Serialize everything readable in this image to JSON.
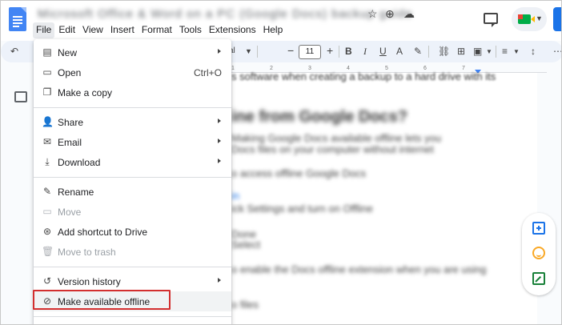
{
  "window": {
    "doc_title": "Microsoft Office & Word on a PC (Google Docs) backup guide",
    "icons": [
      "star-icon",
      "move-icon",
      "cloud-status-icon",
      "comment-icon",
      "meet-icon"
    ]
  },
  "menubar": {
    "items": [
      "File",
      "Edit",
      "View",
      "Insert",
      "Format",
      "Tools",
      "Extensions",
      "Help"
    ]
  },
  "toolbar": {
    "font_name": "al",
    "font_size": "11",
    "ruler_ticks": [
      "1",
      "2",
      "3",
      "4",
      "5",
      "6",
      "7"
    ]
  },
  "document": {
    "lines": [
      "s software when creating a backup to a hard drive with its",
      "ine from Google Docs?",
      "Making Google Docs available offline lets you",
      "Docs files on your computer without internet",
      "o access offline Google Docs",
      "in",
      "ick Settings and turn on Offline",
      "Done",
      "Select",
      "o enable the Docs offline extension when you are using",
      "o files"
    ]
  },
  "file_menu": {
    "groups": [
      [
        {
          "icon": "new-icon",
          "label": "New",
          "shortcut": "",
          "submenu": true,
          "disabled": false
        },
        {
          "icon": "open-folder-icon",
          "label": "Open",
          "shortcut": "Ctrl+O",
          "submenu": false,
          "disabled": false
        },
        {
          "icon": "copy-icon",
          "label": "Make a copy",
          "shortcut": "",
          "submenu": false,
          "disabled": false
        }
      ],
      [
        {
          "icon": "share-person-icon",
          "label": "Share",
          "shortcut": "",
          "submenu": true,
          "disabled": false
        },
        {
          "icon": "email-icon",
          "label": "Email",
          "shortcut": "",
          "submenu": true,
          "disabled": false
        },
        {
          "icon": "download-icon",
          "label": "Download",
          "shortcut": "",
          "submenu": true,
          "disabled": false
        }
      ],
      [
        {
          "icon": "rename-icon",
          "label": "Rename",
          "shortcut": "",
          "submenu": false,
          "disabled": false
        },
        {
          "icon": "move-folder-icon",
          "label": "Move",
          "shortcut": "",
          "submenu": false,
          "disabled": true
        },
        {
          "icon": "add-shortcut-icon",
          "label": "Add shortcut to Drive",
          "shortcut": "",
          "submenu": false,
          "disabled": false
        },
        {
          "icon": "trash-icon",
          "label": "Move to trash",
          "shortcut": "",
          "submenu": false,
          "disabled": true
        }
      ],
      [
        {
          "icon": "history-icon",
          "label": "Version history",
          "shortcut": "",
          "submenu": true,
          "disabled": false
        },
        {
          "icon": "offline-icon",
          "label": "Make available offline",
          "shortcut": "",
          "submenu": false,
          "disabled": false
        }
      ]
    ]
  },
  "colors": {
    "accent": "#1a73e8",
    "highlight_border": "#d32f2f",
    "toolbar_bg": "#edf2fa"
  }
}
